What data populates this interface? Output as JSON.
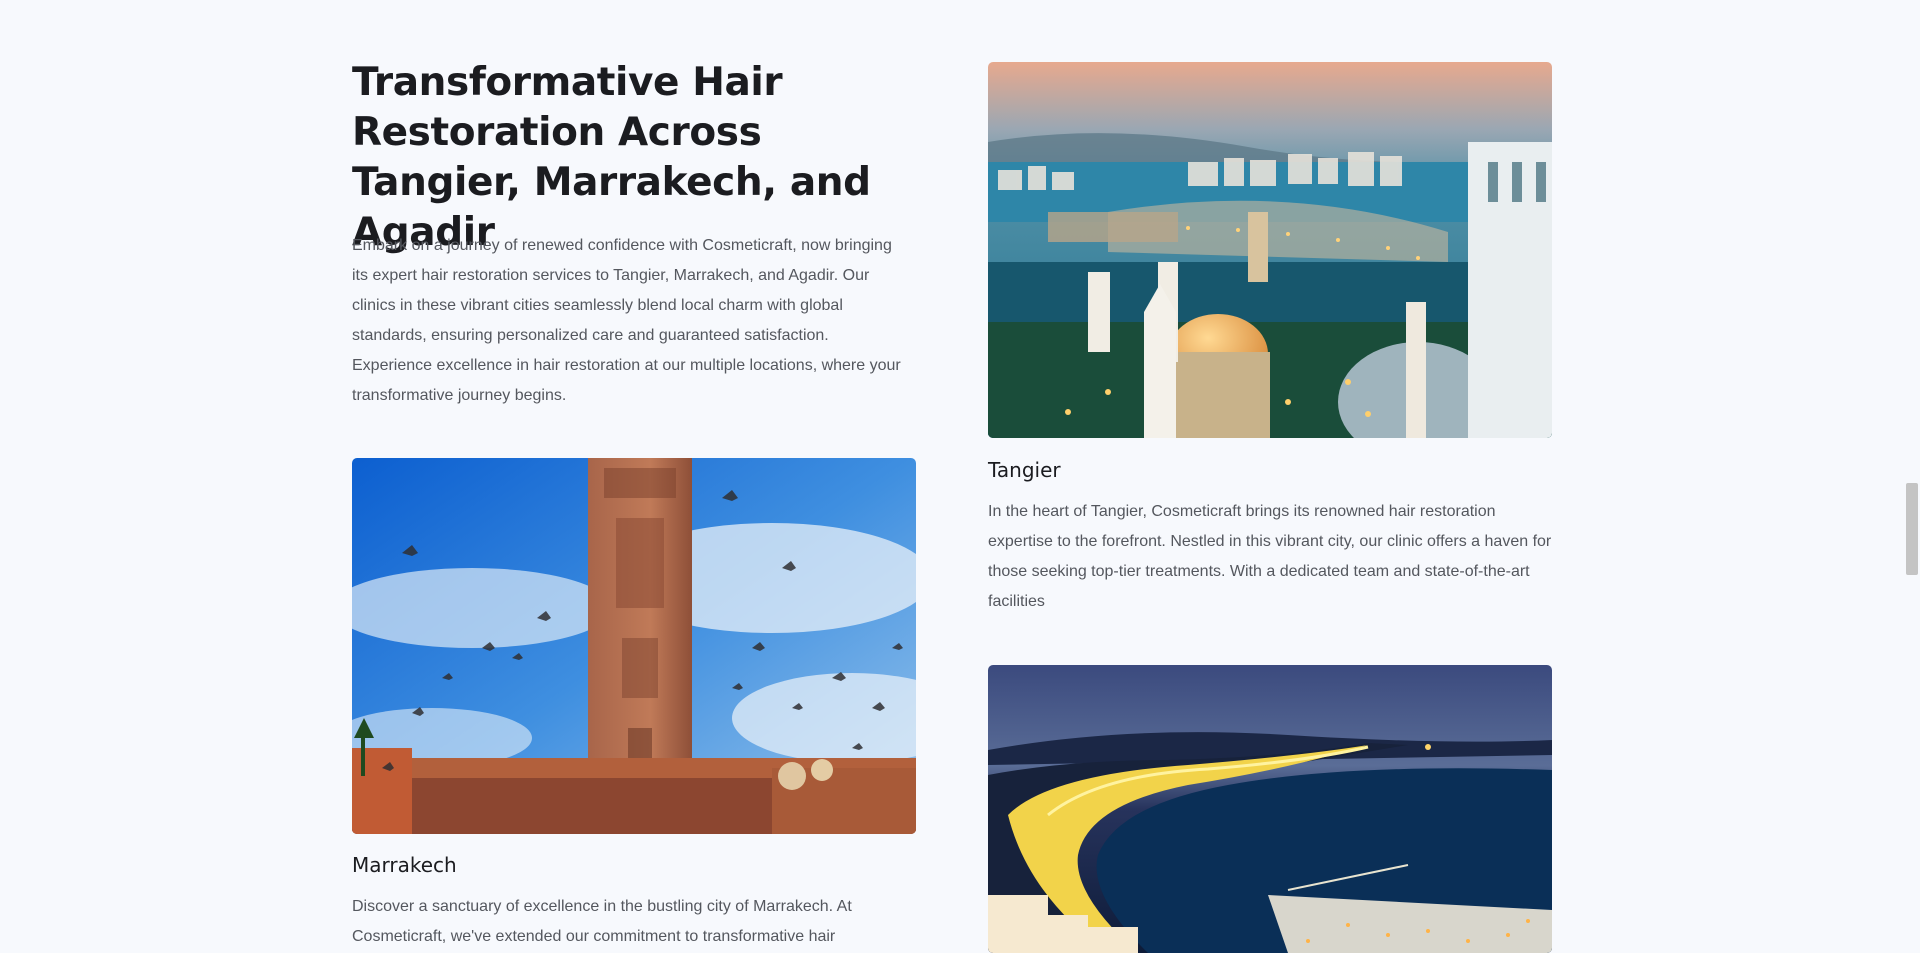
{
  "section": {
    "title": "Transformative Hair Restoration Across Tangier, Marrakech, and Agadir",
    "intro": "Embark on a journey of renewed confidence with Cosmeticraft, now bringing its expert hair restoration services to Tangier, Marrakech, and Agadir. Our clinics in these vibrant cities seamlessly blend local charm with global standards, ensuring personalized care and guaranteed satisfaction. Experience excellence in hair restoration at our multiple locations, where your transformative journey begins."
  },
  "cities": {
    "tangier": {
      "name": "Tangier",
      "description": "In the heart of Tangier, Cosmeticraft brings its renowned hair restoration expertise to the forefront. Nestled in this vibrant city, our clinic offers a haven for those seeking top-tier treatments. With a dedicated team and state-of-the-art facilities",
      "image_icon": "tangier-city-photo"
    },
    "marrakech": {
      "name": "Marrakech",
      "description": "Discover a sanctuary of excellence in the bustling city of Marrakech. At Cosmeticraft, we've extended our commitment to transformative hair",
      "image_icon": "marrakech-koutoubia-photo"
    },
    "agadir": {
      "image_icon": "agadir-bay-night-photo"
    }
  },
  "colors": {
    "background": "#f7f9fd",
    "heading": "#1b1c20",
    "body_text": "#54575e",
    "scrollbar_thumb": "#c4c4c4"
  }
}
